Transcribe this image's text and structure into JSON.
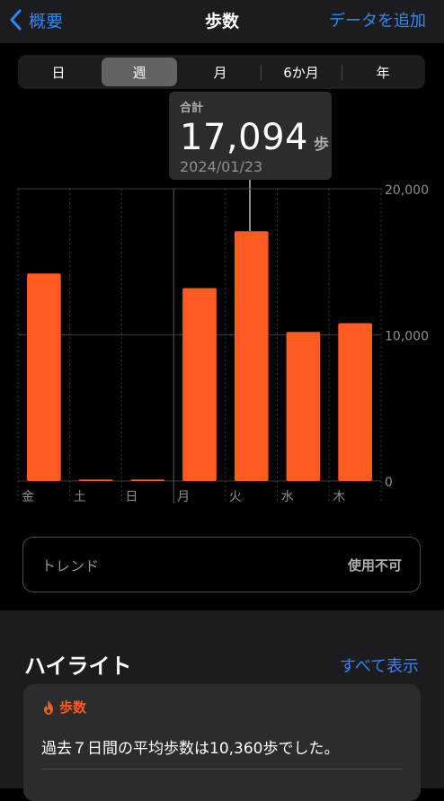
{
  "nav": {
    "back_label": "概要",
    "title": "歩数",
    "add_label": "データを追加"
  },
  "segments": [
    "日",
    "週",
    "月",
    "6か月",
    "年"
  ],
  "active_segment": "週",
  "tooltip": {
    "label": "合計",
    "value": "17,094",
    "unit": "歩",
    "date": "2024/01/23"
  },
  "chart_data": {
    "type": "bar",
    "categories": [
      "金",
      "土",
      "日",
      "月",
      "火",
      "水",
      "木"
    ],
    "values": [
      14200,
      100,
      100,
      13200,
      17094,
      10200,
      10800
    ],
    "ylim": [
      0,
      20000
    ],
    "y_ticks": [
      0,
      10000,
      20000
    ],
    "y_tick_labels": [
      "0",
      "10,000",
      "20,000"
    ],
    "bar_color": "#ff5a1f",
    "grid": true
  },
  "trend": {
    "label": "トレンド",
    "status": "使用不可"
  },
  "highlights": {
    "title": "ハイライト",
    "show_all": "すべて表示",
    "card": {
      "category": "歩数",
      "text": "過去７日間の平均歩数は10,360歩でした。"
    }
  }
}
